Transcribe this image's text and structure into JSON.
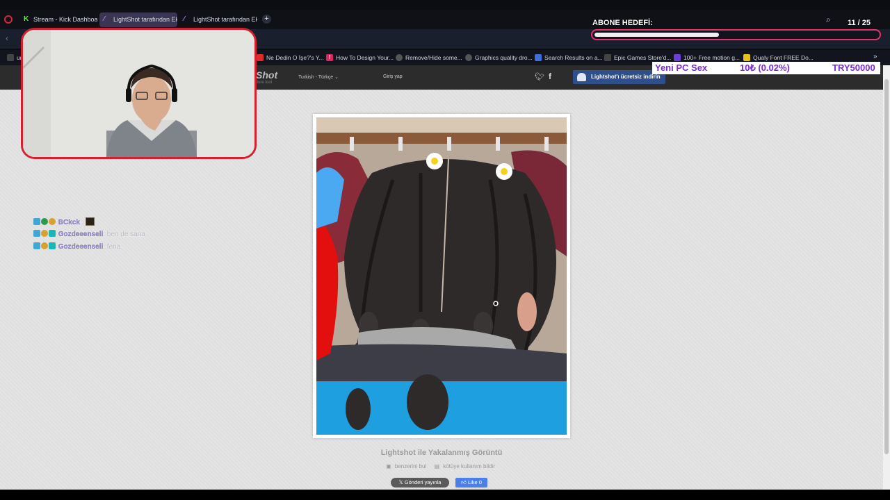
{
  "tabs": [
    {
      "label": "Stream - Kick Dashboard",
      "icon": "kick-icon"
    },
    {
      "label": "LightShot tarafından Ekran",
      "icon": "lightshot-feather-icon"
    },
    {
      "label": "LightShot tarafından Ekran",
      "icon": "lightshot-feather-icon"
    }
  ],
  "bookmarks": [
    {
      "label": "Ne Dedin O İşe?'s Y...",
      "color": "#e02b2b"
    },
    {
      "label": "How To Design Your...",
      "color": "#e0245e"
    },
    {
      "label": "Remove/Hide some...",
      "color": "#555"
    },
    {
      "label": "Graphics quality dro...",
      "color": "#555"
    },
    {
      "label": "Search Results on a...",
      "color": "#3c6fd8"
    },
    {
      "label": "Epic Games Store'd...",
      "color": "#444"
    },
    {
      "label": "100+ Free motion g...",
      "color": "#6b3fd6"
    },
    {
      "label": "Qualy Font FREE Do...",
      "color": "#e5c11c"
    }
  ],
  "lightshot": {
    "logo": "Shot",
    "logo_sub": "pture tool",
    "language": "Turkish - Türkçe ⌄",
    "login": "Giriş yap",
    "download": "Lightshot'ı ücretsiz indirin",
    "caption": "Lightshot ile Yakalanmış Görüntü",
    "find_similar": "benzerini bul",
    "report": "kötüye kullanım bildir",
    "share": "Gönderi yayınla",
    "like": "Like 0"
  },
  "chat": [
    {
      "user": "BCkck",
      "message": ""
    },
    {
      "user": "Gozdeeenseli",
      "message": ": ben de sana"
    },
    {
      "user": "Gozdeeenseli",
      "message": ": fena"
    }
  ],
  "sub_goal": {
    "label": "ABONE HEDEFİ:",
    "current": "11",
    "target": "25",
    "count_text": "11 / 25",
    "progress": 0.44
  },
  "ticker": {
    "name": "Yeni PC Sex",
    "amount": "10₺ (0.02%)",
    "goal": "TRY50000"
  }
}
